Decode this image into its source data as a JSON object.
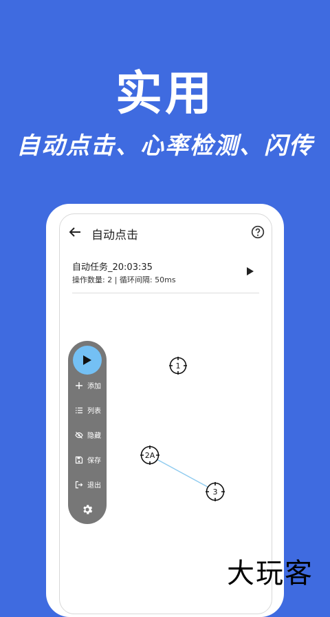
{
  "hero": {
    "title": "实用",
    "subtitle": "自动点击、心率检测、闪传"
  },
  "app_bar": {
    "title": "自动点击",
    "back_icon": "arrow-back-icon",
    "help_icon": "help-circle-icon"
  },
  "task": {
    "name": "自动任务_20:03:35",
    "meta": "操作数量: 2 | 循环间隔: 50ms"
  },
  "float_menu": {
    "items": [
      {
        "label": "添加",
        "icon": "plus-icon"
      },
      {
        "label": "列表",
        "icon": "list-icon"
      },
      {
        "label": "隐藏",
        "icon": "eye-off-icon"
      },
      {
        "label": "保存",
        "icon": "save-icon"
      },
      {
        "label": "退出",
        "icon": "exit-icon"
      }
    ]
  },
  "targets": [
    {
      "label": "1"
    },
    {
      "label": "2A"
    },
    {
      "label": "3"
    }
  ],
  "watermark": "大玩客",
  "colors": {
    "background": "#3f6be0",
    "play_button": "#74c0f4",
    "menu_bg": "#777777",
    "link_line": "#8fcbef"
  }
}
